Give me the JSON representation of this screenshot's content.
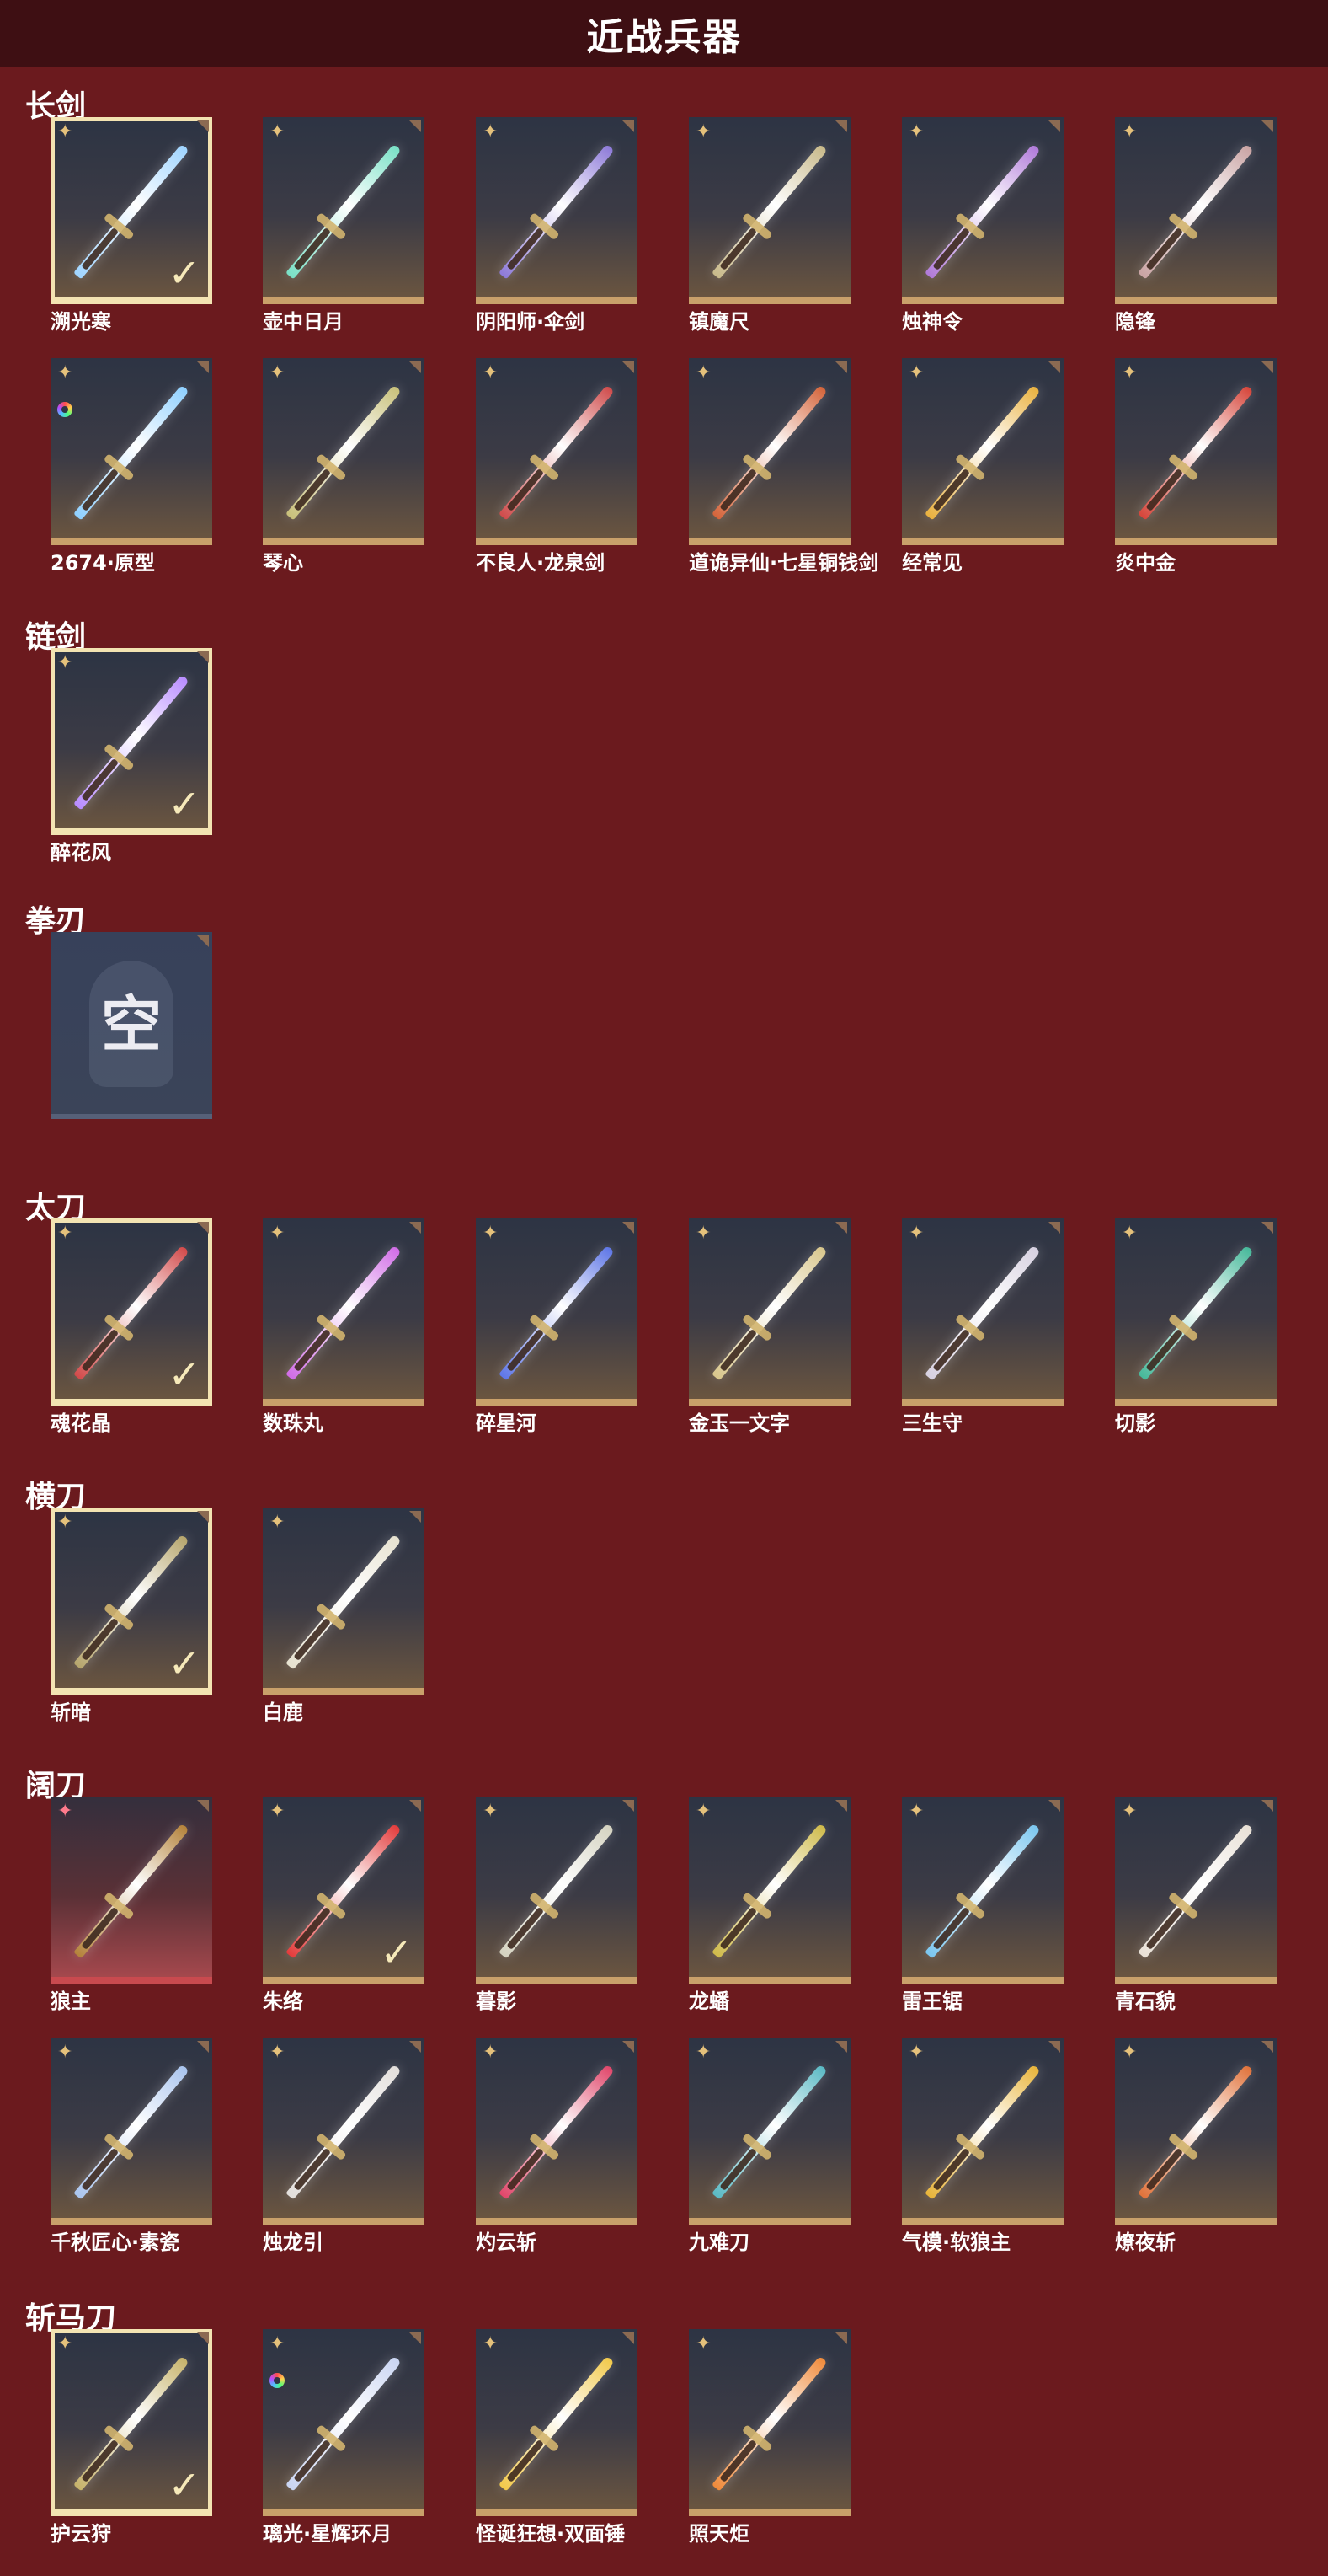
{
  "header": {
    "title": "近战兵器"
  },
  "sections": [
    {
      "title": "长剑",
      "items": [
        {
          "name": "溯光寒",
          "selected": true,
          "badge": "star",
          "color": "#9fd4ff"
        },
        {
          "name": "壶中日月",
          "badge": "star",
          "color": "#79e0c6"
        },
        {
          "name": "阴阳师·伞剑",
          "badge": "star",
          "color": "#8d7ad8"
        },
        {
          "name": "镇魔尺",
          "badge": "star",
          "color": "#c8b98a"
        },
        {
          "name": "烛神令",
          "badge": "star",
          "color": "#b07ad9"
        },
        {
          "name": "隐锋",
          "badge": "star",
          "color": "#c9a3a3"
        },
        {
          "name": "2674·原型",
          "badge": "star",
          "ring": true,
          "color": "#8fd0ff"
        },
        {
          "name": "琴心",
          "badge": "star",
          "color": "#c8c07a"
        },
        {
          "name": "不良人·龙泉剑",
          "badge": "star",
          "color": "#cf4b4b"
        },
        {
          "name": "道诡异仙·七星铜钱剑",
          "badge": "star",
          "color": "#d4643a"
        },
        {
          "name": "经常见",
          "badge": "star",
          "color": "#e9b13f"
        },
        {
          "name": "炎中金",
          "badge": "star",
          "color": "#d6453a"
        }
      ]
    },
    {
      "title": "链剑",
      "items": [
        {
          "name": "醉花风",
          "selected": true,
          "badge": "star",
          "color": "#b88cff"
        }
      ]
    },
    {
      "title": "拳刃",
      "items": [
        {
          "empty": true,
          "empty_text": "空"
        }
      ]
    },
    {
      "title": "太刀",
      "items": [
        {
          "name": "魂花晶",
          "selected": true,
          "badge": "star",
          "color": "#d24a4a"
        },
        {
          "name": "数珠丸",
          "badge": "star",
          "color": "#d06ce6"
        },
        {
          "name": "碎星河",
          "badge": "star",
          "color": "#5e76e6"
        },
        {
          "name": "金玉一文字",
          "badge": "star",
          "color": "#d8c68c"
        },
        {
          "name": "三生守",
          "badge": "star",
          "color": "#d6d0e0"
        },
        {
          "name": "切影",
          "badge": "star",
          "color": "#46b89a"
        }
      ]
    },
    {
      "title": "横刀",
      "items": [
        {
          "name": "斩暗",
          "selected": true,
          "badge": "star",
          "color": "#b6a56c"
        },
        {
          "name": "白鹿",
          "badge": "star",
          "color": "#e6e1cf"
        }
      ]
    },
    {
      "title": "阔刀",
      "items": [
        {
          "name": "狼主",
          "badge": "pink-star",
          "red": true,
          "color": "#b4823a"
        },
        {
          "name": "朱络",
          "badge": "star",
          "check": true,
          "color": "#e33b3b"
        },
        {
          "name": "暮影",
          "badge": "star",
          "color": "#d4d2c0"
        },
        {
          "name": "龙蟠",
          "badge": "star",
          "color": "#cfba4a"
        },
        {
          "name": "雷王锯",
          "badge": "star",
          "color": "#7ac6ef"
        },
        {
          "name": "青石貌",
          "badge": "star",
          "color": "#e8e0d6"
        },
        {
          "name": "千秋匠心·素瓷",
          "badge": "star",
          "color": "#a9c4ee"
        },
        {
          "name": "烛龙引",
          "badge": "star",
          "color": "#e2dedb"
        },
        {
          "name": "灼云斩",
          "badge": "star",
          "color": "#e0466a"
        },
        {
          "name": "九难刀",
          "badge": "star",
          "color": "#5ab9c4"
        },
        {
          "name": "气模·软狼主",
          "badge": "star",
          "color": "#e8b43a"
        },
        {
          "name": "燎夜斩",
          "badge": "star",
          "color": "#e0723a"
        }
      ]
    },
    {
      "title": "斩马刀",
      "items": [
        {
          "name": "护云狩",
          "selected": true,
          "badge": "star",
          "color": "#c6b26a"
        },
        {
          "name": "璃光·星辉环月",
          "badge": "star",
          "ring": true,
          "color": "#c9d4f2"
        },
        {
          "name": "怪诞狂想·双面锤",
          "badge": "star",
          "color": "#f2c94a"
        },
        {
          "name": "照天炬",
          "badge": "star",
          "color": "#f08a3a"
        }
      ]
    }
  ],
  "icons": {
    "star": "✦",
    "check": "✓"
  },
  "colors": {
    "background": "#6b1a1e",
    "header": "#3e0f13",
    "gold_border": "#c9a06a",
    "selected_border": "#f3e3b2"
  }
}
